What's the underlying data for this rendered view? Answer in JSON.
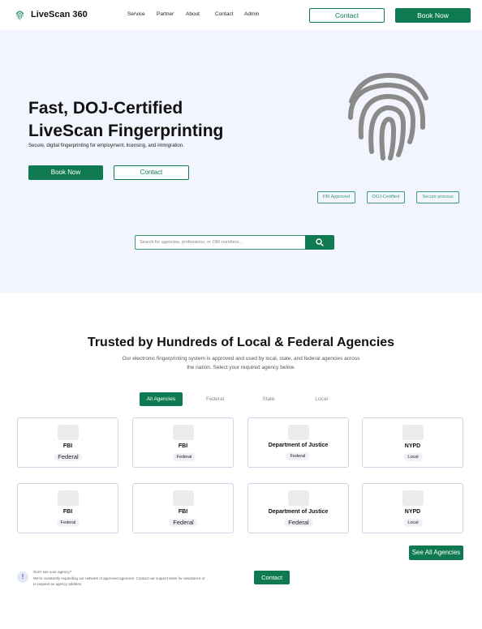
{
  "header": {
    "brand": "LiveScan 360",
    "nav": [
      "Service",
      "Partner",
      "About",
      "Contact",
      "Admin"
    ],
    "contact_label": "Contact",
    "book_label": "Book Now"
  },
  "hero": {
    "title_line1": "Fast, DOJ-Certified",
    "title_line2": "LiveScan Fingerprinting",
    "subtitle": "Secure, digital fingerprinting for employment, licensing, and immigration.",
    "book_label": "Book Now",
    "contact_label": "Contact",
    "badges": [
      "FBI Approved",
      "DOJ-Certified",
      "Secure process"
    ],
    "search_placeholder": "Search for agencies, professions, or ORI numbers...",
    "icon": "fingerprint-icon"
  },
  "agencies": {
    "title": "Trusted by Hundreds of  Local & Federal Agencies",
    "desc_line1": "Our electronic fingerprinting system is approved and used by local, state, and federal agencies across",
    "desc_line2": "the nation. Select your required agency below.",
    "tabs": [
      "All Agencies",
      "Federal",
      "State",
      "Local"
    ],
    "active_tab": "All Agencies",
    "cards": [
      {
        "name": "FBI",
        "tag": "Federal"
      },
      {
        "name": "FBI",
        "tag": "Federal"
      },
      {
        "name": "Department of Justice",
        "tag": "Federal"
      },
      {
        "name": "NYPD",
        "tag": "Local"
      },
      {
        "name": "FBI",
        "tag": "Federal"
      },
      {
        "name": "FBI",
        "tag": "Federal"
      },
      {
        "name": "Department of Justice",
        "tag": "Federal"
      },
      {
        "name": "NYPD",
        "tag": "Local"
      }
    ],
    "see_all_label": "See All Agencies"
  },
  "help": {
    "icon_glyph": "!",
    "title": "Don't see your agency?",
    "text_line1": "We're constantly expanding our network of approved agencies. Contact our support team for assistance or",
    "text_line2": "to request an agency addition.",
    "contact_label": "Contact"
  },
  "colors": {
    "primary": "#0f7a52",
    "hero_bg": "#f2f5fd",
    "fingerprint": "#8a8a8a"
  }
}
